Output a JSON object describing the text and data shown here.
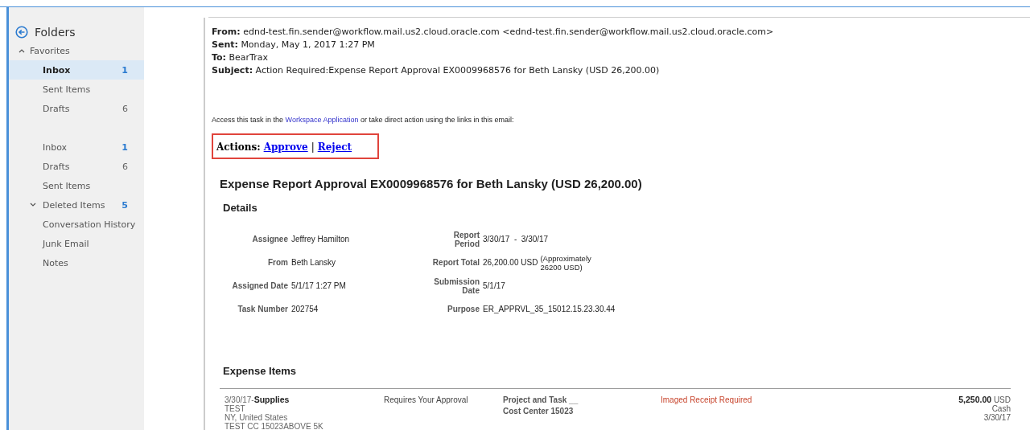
{
  "sidebar": {
    "title": "Folders",
    "groups": [
      {
        "label": "Favorites",
        "expanded": true,
        "items": [
          {
            "label": "Inbox",
            "count": "1",
            "unread": true,
            "selected": true
          },
          {
            "label": "Sent Items",
            "selected": false
          },
          {
            "label": "Drafts",
            "count": "6",
            "unread": false,
            "selected": false
          }
        ]
      },
      {
        "items": [
          {
            "label": "Inbox",
            "count": "1",
            "unread": true,
            "selected": false
          },
          {
            "label": "Drafts",
            "count": "6",
            "unread": false,
            "selected": false
          },
          {
            "label": "Sent Items",
            "selected": false
          },
          {
            "label": "Deleted Items",
            "count": "5",
            "unread": true,
            "expanded": false,
            "selected": false
          },
          {
            "label": "Conversation History",
            "selected": false
          },
          {
            "label": "Junk Email",
            "selected": false
          },
          {
            "label": "Notes",
            "selected": false
          }
        ]
      }
    ]
  },
  "email": {
    "headers": [
      {
        "label": "From:",
        "value": "ednd-test.fin.sender@workflow.mail.us2.cloud.oracle.com <ednd-test.fin.sender@workflow.mail.us2.cloud.oracle.com>"
      },
      {
        "label": "Sent:",
        "value": "Monday, May 1, 2017 1:27 PM"
      },
      {
        "label": "To:",
        "value": "BearTrax"
      },
      {
        "label": "Subject:",
        "value": "Action Required:Expense Report Approval EX0009968576 for Beth Lansky (USD 26,200.00)"
      }
    ],
    "access": {
      "before": "Access this task in the",
      "link": "Workspace Application",
      "after": "or take direct action using the links in this email:"
    },
    "actions": {
      "label": "Actions:",
      "links": [
        "Approve",
        "Reject"
      ],
      "separator": "|"
    },
    "title": "Expense Report Approval EX0009968576 for Beth Lansky (USD 26,200.00)",
    "details": {
      "heading": "Details",
      "rows": [
        [
          {
            "label": "Assignee",
            "value": "Jeffrey Hamilton"
          },
          {
            "label": "Report Period",
            "value": "3/30/17  -  3/30/17"
          }
        ],
        [
          {
            "label": "From",
            "value": "Beth Lansky"
          },
          {
            "label": "Report Total",
            "value": "26,200.00 USD",
            "note": "(Approximately 26200 USD)"
          }
        ],
        [
          {
            "label": "Assigned Date",
            "value": "5/1/17 1:27 PM"
          },
          {
            "label": "Submission Date",
            "value": "5/1/17"
          }
        ],
        [
          {
            "label": "Task Number",
            "value": "202754"
          },
          {
            "label": "Purpose",
            "value": "ER_APPRVL_35_15012.15.23.30.44"
          }
        ]
      ]
    },
    "expense_items": {
      "heading": "Expense Items",
      "rows": [
        {
          "date": "3/30/17-",
          "type": "Supplies",
          "lines": [
            "TEST",
            "NY, United States",
            "TEST CC 15023ABOVE 5K"
          ],
          "status": "Requires Your Approval",
          "project_label": "Project and Task",
          "project_value": "__",
          "cost_center": "Cost Center 15023",
          "receipt": "Imaged Receipt Required",
          "amount": "5,250.00",
          "currency": "USD",
          "payment": "Cash",
          "amount_date": "3/30/17"
        }
      ]
    }
  }
}
